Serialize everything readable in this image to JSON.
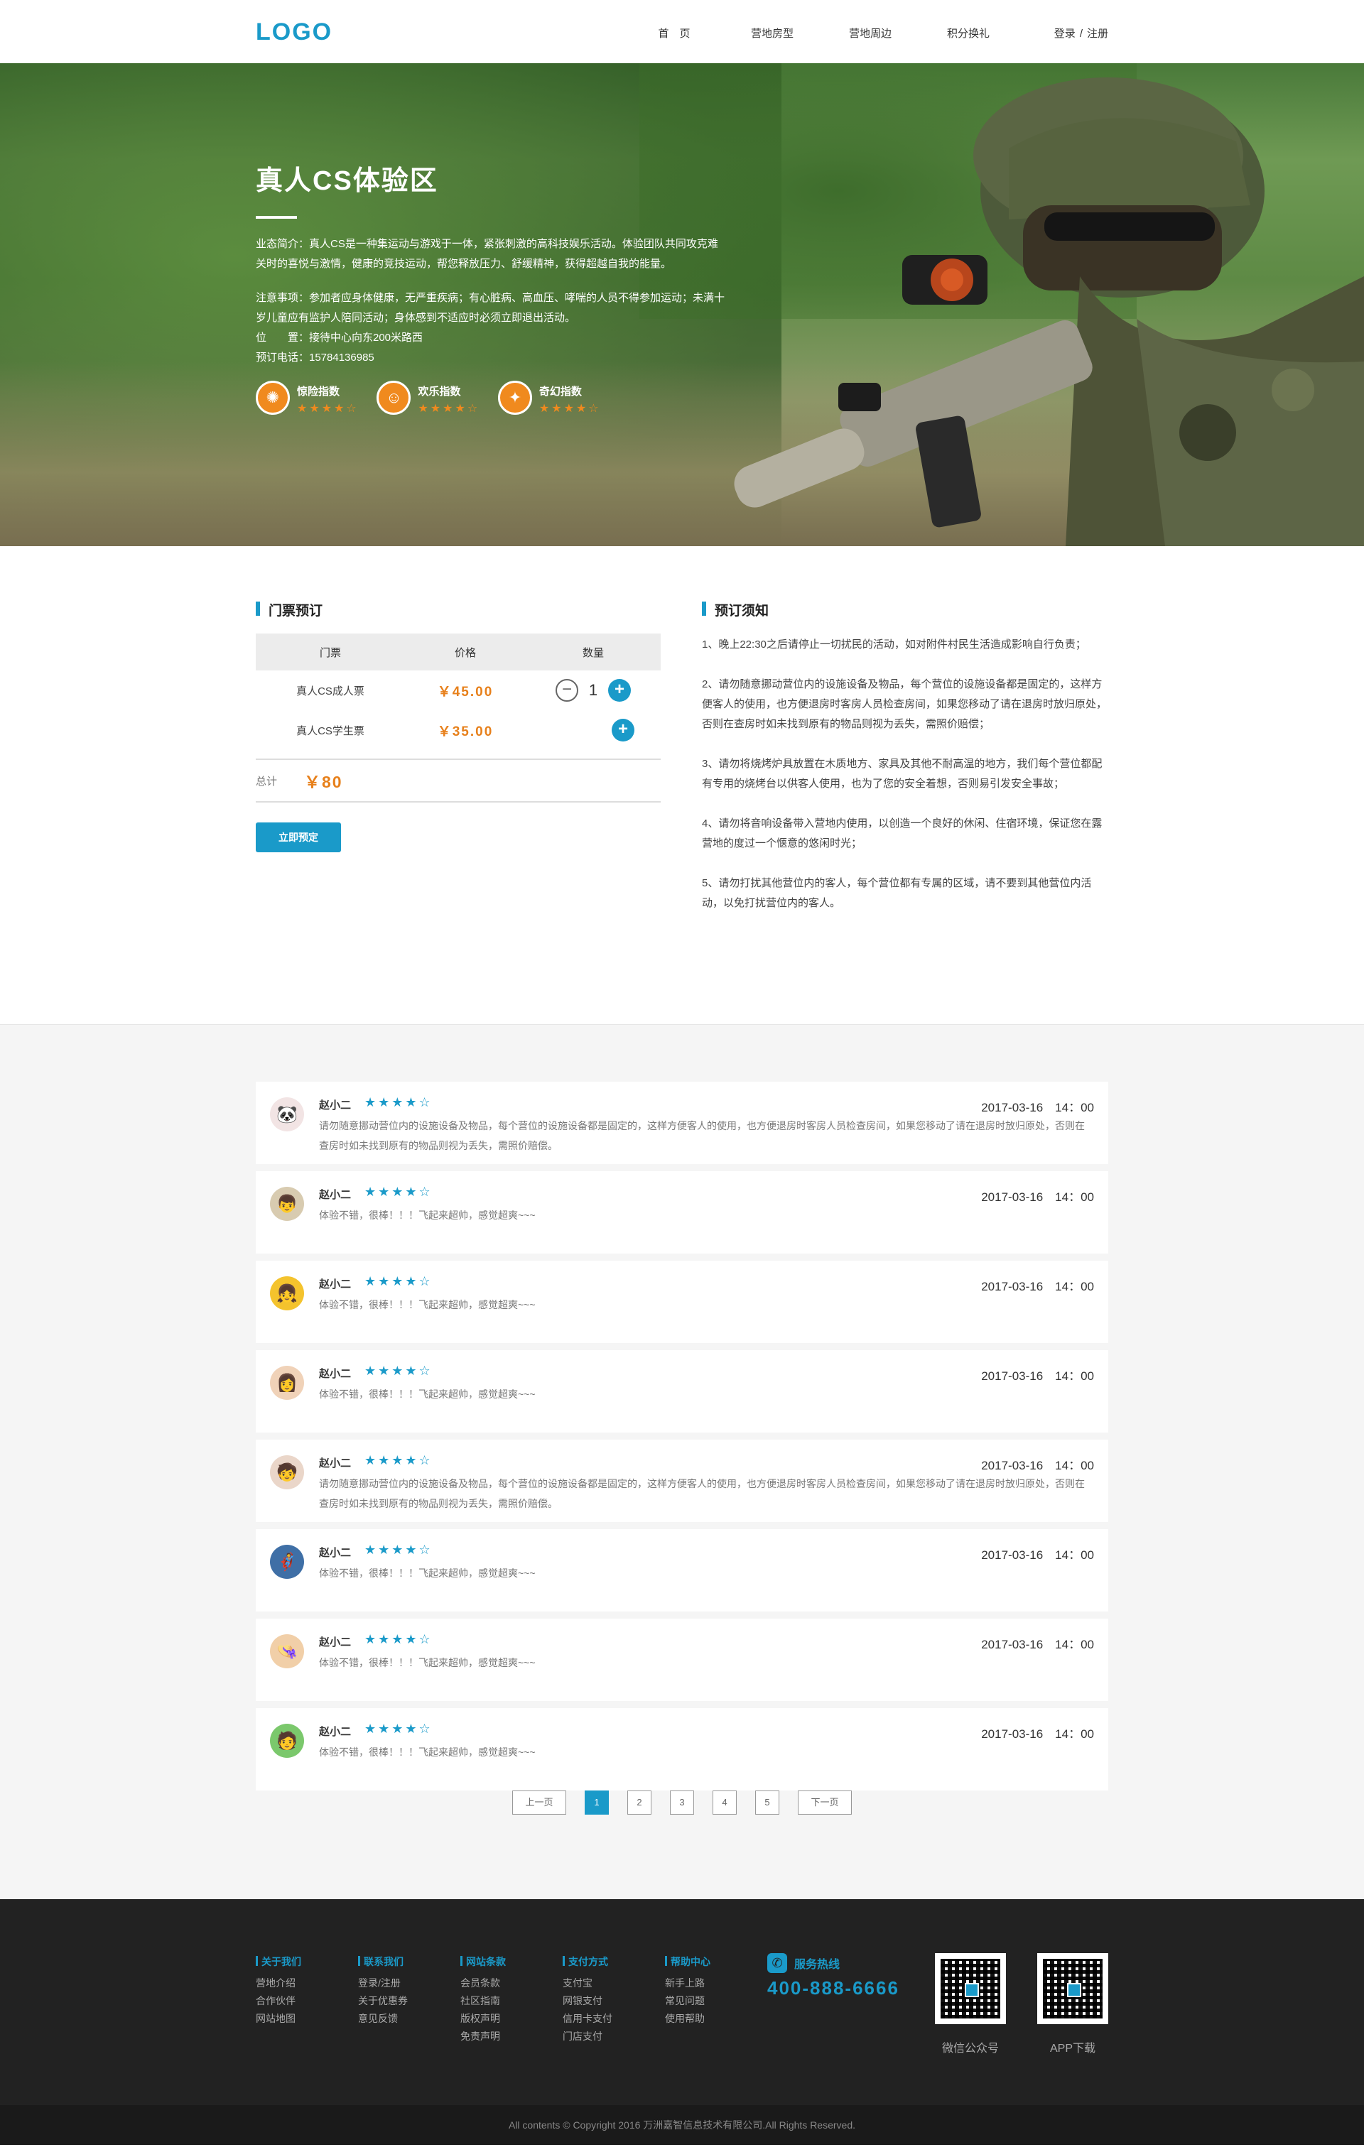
{
  "header": {
    "logo": "LOGO",
    "nav": [
      "首　页",
      "营地房型",
      "营地周边",
      "积分换礼"
    ],
    "login": "登录",
    "separator": "/",
    "register": "注册"
  },
  "hero": {
    "title": "真人CS体验区",
    "intro": "业态简介：真人CS是一种集运动与游戏于一体，紧张刺激的高科技娱乐活动。体验团队共同攻克难关时的喜悦与激情，健康的竞技运动，帮您释放压力、舒缓精神，获得超越自我的能量。",
    "attention": "注意事项：参加者应身体健康，无严重疾病；有心脏病、高血压、哮喘的人员不得参加运动；未满十岁儿童应有监护人陪同活动；身体感到不适应时必须立即退出活动。",
    "location": "位　　置：接待中心向东200米路西",
    "phone": "预订电话：15784136985",
    "indices": [
      {
        "label": "惊险指数",
        "icon": "bomb-icon",
        "glyph": "✺",
        "stars": "★★★★☆",
        "rating": 4
      },
      {
        "label": "欢乐指数",
        "icon": "smile-icon",
        "glyph": "☺",
        "stars": "★★★★☆",
        "rating": 4
      },
      {
        "label": "奇幻指数",
        "icon": "star-burst-icon",
        "glyph": "✦",
        "stars": "★★★★☆",
        "rating": 4
      }
    ]
  },
  "ticket": {
    "title": "门票预订",
    "headers": [
      "门票",
      "价格",
      "数量"
    ],
    "rows": [
      {
        "name": "真人CS成人票",
        "price": "￥45.00",
        "qty": "1"
      },
      {
        "name": "真人CS学生票",
        "price": "￥35.00"
      }
    ],
    "total_label": "总计",
    "total": "￥80",
    "book_button": "立即预定",
    "minus": "−",
    "plus": "+"
  },
  "notice": {
    "title": "预订须知",
    "items": [
      "1、晚上22:30之后请停止一切扰民的活动，如对附件村民生活造成影响自行负责；",
      "2、请勿随意挪动营位内的设施设备及物品，每个营位的设施设备都是固定的，这样方便客人的使用，也方便退房时客房人员检查房间，如果您移动了请在退房时放归原处，否则在查房时如未找到原有的物品则视为丢失，需照价赔偿；",
      "3、请勿将烧烤炉具放置在木质地方、家具及其他不耐高温的地方，我们每个营位都配有专用的烧烤台以供客人使用，也为了您的安全着想，否则易引发安全事故；",
      "4、请勿将音响设备带入营地内使用，以创造一个良好的休闲、住宿环境，保证您在露营地的度过一个惬意的悠闲时光；",
      "5、请勿打扰其他营位内的客人，每个营位都有专属的区域，请不要到其他营位内活动，以免打扰营位内的客人。"
    ]
  },
  "comments": [
    {
      "name": "赵小二",
      "stars": "★★★★☆",
      "rating": 4,
      "date": "2017-03-16　14：00",
      "text": "请勿随意挪动营位内的设施设备及物品，每个营位的设施设备都是固定的，这样方便客人的使用，也方便退房时客房人员检查房间，如果您移动了请在退房时放归原处，否则在查房时如未找到原有的物品则视为丢失，需照价赔偿。",
      "avatar": "🐼",
      "avatar_bg": "#f2e4e4"
    },
    {
      "name": "赵小二",
      "stars": "★★★★☆",
      "rating": 4,
      "date": "2017-03-16　14：00",
      "text": "体验不错，很棒！！！飞起来超帅，感觉超爽~~~",
      "avatar": "👦",
      "avatar_bg": "#d8cbb0"
    },
    {
      "name": "赵小二",
      "stars": "★★★★☆",
      "rating": 4,
      "date": "2017-03-16　14：00",
      "text": "体验不错，很棒！！！飞起来超帅，感觉超爽~~~",
      "avatar": "👧",
      "avatar_bg": "#f4c32d"
    },
    {
      "name": "赵小二",
      "stars": "★★★★☆",
      "rating": 4,
      "date": "2017-03-16　14：00",
      "text": "体验不错，很棒！！！飞起来超帅，感觉超爽~~~",
      "avatar": "👩",
      "avatar_bg": "#f0d2b8"
    },
    {
      "name": "赵小二",
      "stars": "★★★★☆",
      "rating": 4,
      "date": "2017-03-16　14：00",
      "text": "请勿随意挪动营位内的设施设备及物品，每个营位的设施设备都是固定的，这样方便客人的使用，也方便退房时客房人员检查房间，如果您移动了请在退房时放归原处，否则在查房时如未找到原有的物品则视为丢失，需照价赔偿。",
      "avatar": "🧒",
      "avatar_bg": "#ead6c9"
    },
    {
      "name": "赵小二",
      "stars": "★★★★☆",
      "rating": 4,
      "date": "2017-03-16　14：00",
      "text": "体验不错，很棒！！！飞起来超帅，感觉超爽~~~",
      "avatar": "🦸",
      "avatar_bg": "#3f6fa6"
    },
    {
      "name": "赵小二",
      "stars": "★★★★☆",
      "rating": 4,
      "date": "2017-03-16　14：00",
      "text": "体验不错，很棒！！！飞起来超帅，感觉超爽~~~",
      "avatar": "👒",
      "avatar_bg": "#f1cfa8"
    },
    {
      "name": "赵小二",
      "stars": "★★★★☆",
      "rating": 4,
      "date": "2017-03-16　14：00",
      "text": "体验不错，很棒！！！飞起来超帅，感觉超爽~~~",
      "avatar": "🧑",
      "avatar_bg": "#7bc86c"
    }
  ],
  "pager": {
    "prev": "上一页",
    "pages": [
      "1",
      "2",
      "3",
      "4",
      "5"
    ],
    "active": "1",
    "next": "下一页"
  },
  "footer": {
    "columns": [
      {
        "title": "关于我们",
        "links": [
          "营地介绍",
          "合作伙伴",
          "网站地图"
        ]
      },
      {
        "title": "联系我们",
        "links": [
          "登录/注册",
          "关于优惠券",
          "意见反馈"
        ]
      },
      {
        "title": "网站条款",
        "links": [
          "会员条款",
          "社区指南",
          "版权声明",
          "免责声明"
        ]
      },
      {
        "title": "支付方式",
        "links": [
          "支付宝",
          "网银支付",
          "信用卡支付",
          "门店支付"
        ]
      },
      {
        "title": "帮助中心",
        "links": [
          "新手上路",
          "常见问题",
          "使用帮助"
        ]
      }
    ],
    "hotline_label": "服务热线",
    "hotline": "400-888-6666",
    "qr1_label": "微信公众号",
    "qr2_label": "APP下载",
    "copyright": "All contents © Copyright 2016 万洲嘉智信息技术有限公司.All Rights Reserved."
  },
  "colors": {
    "accent": "#1a9ac9",
    "orange": "#f08a1e",
    "footer_bg": "#222222"
  }
}
